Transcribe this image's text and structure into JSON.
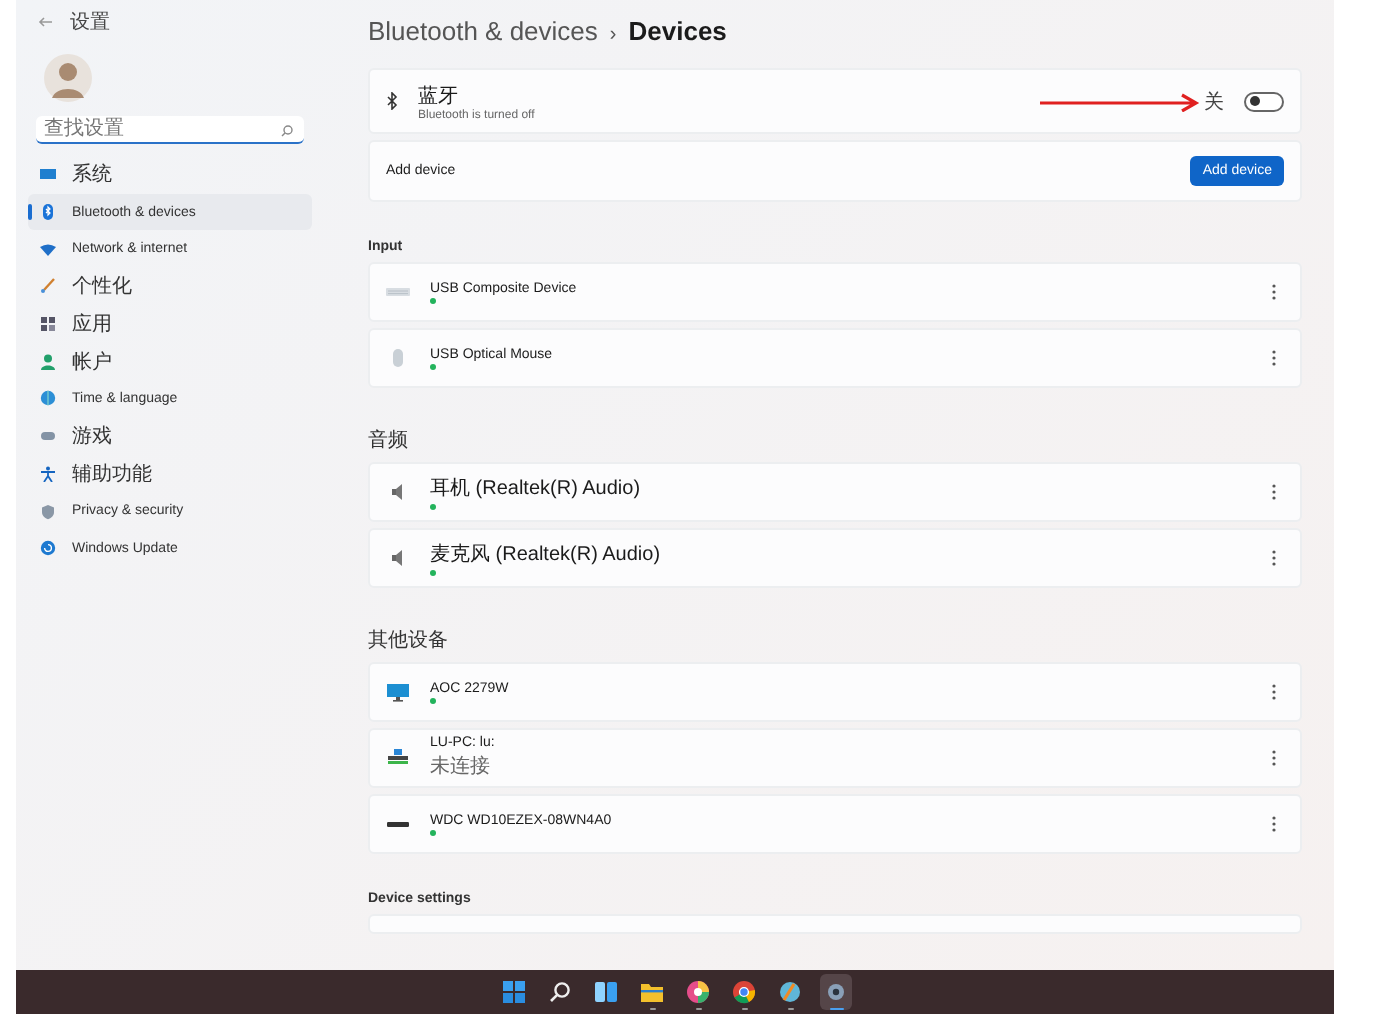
{
  "window": {
    "title": "设置"
  },
  "search": {
    "placeholder": "查找设置"
  },
  "sidebar": {
    "items": [
      {
        "label": "系统",
        "kind": "system",
        "selected": false
      },
      {
        "label": "Bluetooth & devices",
        "kind": "bluetooth",
        "selected": true
      },
      {
        "label": "Network & internet",
        "kind": "network",
        "selected": false
      },
      {
        "label": "个性化",
        "kind": "brush",
        "selected": false
      },
      {
        "label": "应用",
        "kind": "apps",
        "selected": false
      },
      {
        "label": "帐户",
        "kind": "person",
        "selected": false
      },
      {
        "label": "Time & language",
        "kind": "globe",
        "selected": false
      },
      {
        "label": "游戏",
        "kind": "game",
        "selected": false
      },
      {
        "label": "辅助功能",
        "kind": "access",
        "selected": false
      },
      {
        "label": "Privacy & security",
        "kind": "shield",
        "selected": false
      },
      {
        "label": "Windows Update",
        "kind": "update",
        "selected": false
      }
    ]
  },
  "breadcrumb": {
    "parent": "Bluetooth & devices",
    "separator": "›",
    "current": "Devices"
  },
  "bluetooth": {
    "title": "蓝牙",
    "subtitle": "Bluetooth is turned off",
    "state_label": "关",
    "on": false
  },
  "add_device": {
    "label": "Add device",
    "button": "Add device"
  },
  "sections": [
    {
      "title": "Input",
      "devices": [
        {
          "name": "USB Composite Device",
          "kind": "keyboard",
          "connected": true
        },
        {
          "name": "USB Optical Mouse",
          "kind": "mouse",
          "connected": true
        }
      ]
    },
    {
      "title": "音频",
      "devices": [
        {
          "name": "耳机 (Realtek(R) Audio)",
          "kind": "speaker",
          "connected": true
        },
        {
          "name": "麦克风 (Realtek(R) Audio)",
          "kind": "speaker",
          "connected": true
        }
      ]
    },
    {
      "title": "其他设备",
      "devices": [
        {
          "name": "AOC 2279W",
          "kind": "monitor",
          "connected": true
        },
        {
          "name": "LU-PC: lu:",
          "kind": "pc",
          "connected": false,
          "status": "未连接"
        },
        {
          "name": "WDC WD10EZEX-08WN4A0",
          "kind": "drive",
          "connected": true
        }
      ]
    },
    {
      "title": "Device settings"
    }
  ],
  "taskbar": {
    "apps": [
      {
        "kind": "start",
        "running": false,
        "selected": false
      },
      {
        "kind": "search",
        "running": false,
        "selected": false
      },
      {
        "kind": "widgets",
        "running": false,
        "selected": false
      },
      {
        "kind": "folder",
        "running": true,
        "selected": false
      },
      {
        "kind": "colorball",
        "running": true,
        "selected": false
      },
      {
        "kind": "chrome",
        "running": true,
        "selected": false
      },
      {
        "kind": "paint",
        "running": true,
        "selected": false
      },
      {
        "kind": "settings",
        "running": true,
        "selected": true
      }
    ]
  }
}
